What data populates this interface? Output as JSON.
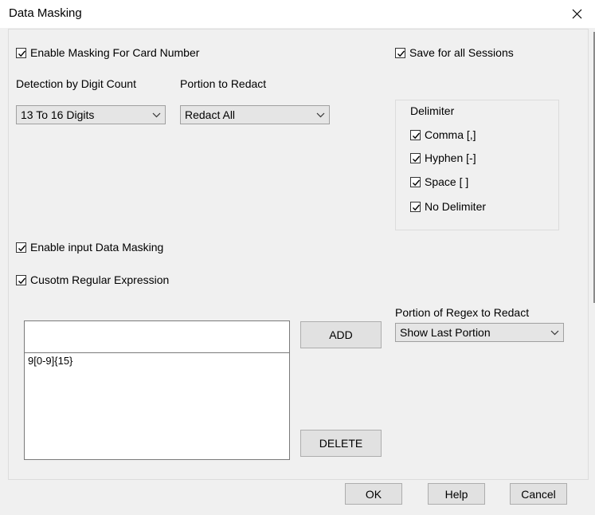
{
  "window": {
    "title": "Data Masking"
  },
  "options": {
    "enable_card_masking": {
      "label": "Enable Masking For Card Number",
      "checked": true
    },
    "save_all_sessions": {
      "label": "Save for all Sessions",
      "checked": true
    },
    "enable_input_masking": {
      "label": "Enable input Data Masking",
      "checked": true
    },
    "custom_regex": {
      "label": "Cusotm Regular Expression",
      "checked": true
    }
  },
  "detection": {
    "label": "Detection by Digit Count",
    "selected": "13 To 16 Digits"
  },
  "portion": {
    "label": "Portion to Redact",
    "selected": "Redact All"
  },
  "delimiter": {
    "title": "Delimiter",
    "items": [
      {
        "label": "Comma [,]",
        "checked": true
      },
      {
        "label": "Hyphen [-]",
        "checked": true
      },
      {
        "label": "Space [ ]",
        "checked": true
      },
      {
        "label": "No Delimiter",
        "checked": true
      }
    ]
  },
  "regex": {
    "input_value": "",
    "list": [
      "9[0-9]{15}"
    ],
    "portion_label": "Portion of Regex to Redact",
    "portion_selected": "Show Last Portion",
    "add_label": "ADD",
    "delete_label": "DELETE"
  },
  "footer": {
    "ok_label": "OK",
    "help_label": "Help",
    "cancel_label": "Cancel"
  }
}
